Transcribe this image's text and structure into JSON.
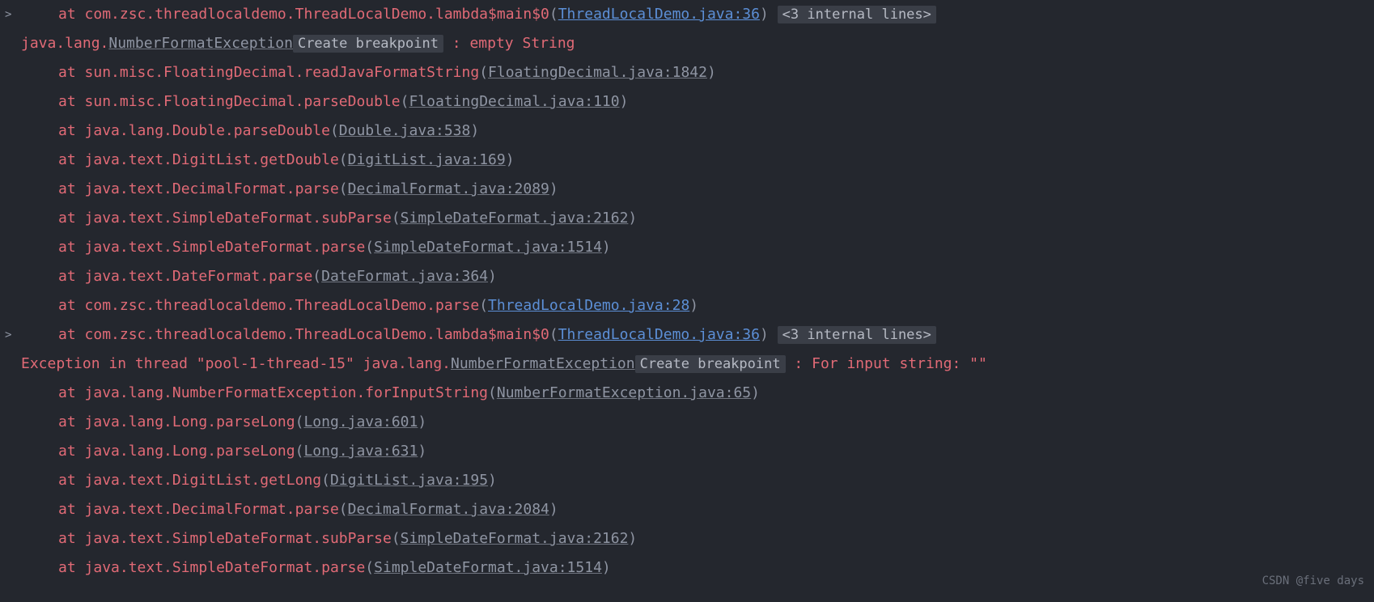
{
  "gutter": ">",
  "badges": {
    "internal": "<3 internal lines>",
    "breakpoint": "Create breakpoint"
  },
  "lines": [
    {
      "indent": 1,
      "gutter": true,
      "parts": [
        {
          "cls": "at",
          "t": "at "
        },
        {
          "cls": "red",
          "t": "com.zsc.threadlocaldemo.ThreadLocalDemo.lambda$main$0"
        },
        {
          "cls": "grey",
          "t": "("
        },
        {
          "cls": "link-blue",
          "t": "ThreadLocalDemo.java:36",
          "interact": true
        },
        {
          "cls": "grey",
          "t": ") "
        },
        {
          "badge": "internal",
          "interact": true
        }
      ]
    },
    {
      "indent": 0,
      "parts": [
        {
          "cls": "red",
          "t": "java.lang."
        },
        {
          "cls": "link-grey",
          "t": "NumberFormatException",
          "interact": true
        },
        {
          "badge": "breakpoint",
          "interact": true
        },
        {
          "cls": "red",
          "t": " : empty String"
        }
      ]
    },
    {
      "indent": 1,
      "parts": [
        {
          "cls": "at",
          "t": "at "
        },
        {
          "cls": "red",
          "t": "sun.misc.FloatingDecimal.readJavaFormatString"
        },
        {
          "cls": "grey",
          "t": "("
        },
        {
          "cls": "link-grey",
          "t": "FloatingDecimal.java:1842",
          "interact": true
        },
        {
          "cls": "grey",
          "t": ")"
        }
      ]
    },
    {
      "indent": 1,
      "parts": [
        {
          "cls": "at",
          "t": "at "
        },
        {
          "cls": "red",
          "t": "sun.misc.FloatingDecimal.parseDouble"
        },
        {
          "cls": "grey",
          "t": "("
        },
        {
          "cls": "link-grey",
          "t": "FloatingDecimal.java:110",
          "interact": true
        },
        {
          "cls": "grey",
          "t": ")"
        }
      ]
    },
    {
      "indent": 1,
      "parts": [
        {
          "cls": "at",
          "t": "at "
        },
        {
          "cls": "red",
          "t": "java.lang.Double.parseDouble"
        },
        {
          "cls": "grey",
          "t": "("
        },
        {
          "cls": "link-grey",
          "t": "Double.java:538",
          "interact": true
        },
        {
          "cls": "grey",
          "t": ")"
        }
      ]
    },
    {
      "indent": 1,
      "parts": [
        {
          "cls": "at",
          "t": "at "
        },
        {
          "cls": "red",
          "t": "java.text.DigitList.getDouble"
        },
        {
          "cls": "grey",
          "t": "("
        },
        {
          "cls": "link-grey",
          "t": "DigitList.java:169",
          "interact": true
        },
        {
          "cls": "grey",
          "t": ")"
        }
      ]
    },
    {
      "indent": 1,
      "parts": [
        {
          "cls": "at",
          "t": "at "
        },
        {
          "cls": "red",
          "t": "java.text.DecimalFormat.parse"
        },
        {
          "cls": "grey",
          "t": "("
        },
        {
          "cls": "link-grey",
          "t": "DecimalFormat.java:2089",
          "interact": true
        },
        {
          "cls": "grey",
          "t": ")"
        }
      ]
    },
    {
      "indent": 1,
      "parts": [
        {
          "cls": "at",
          "t": "at "
        },
        {
          "cls": "red",
          "t": "java.text.SimpleDateFormat.subParse"
        },
        {
          "cls": "grey",
          "t": "("
        },
        {
          "cls": "link-grey",
          "t": "SimpleDateFormat.java:2162",
          "interact": true
        },
        {
          "cls": "grey",
          "t": ")"
        }
      ]
    },
    {
      "indent": 1,
      "parts": [
        {
          "cls": "at",
          "t": "at "
        },
        {
          "cls": "red",
          "t": "java.text.SimpleDateFormat.parse"
        },
        {
          "cls": "grey",
          "t": "("
        },
        {
          "cls": "link-grey",
          "t": "SimpleDateFormat.java:1514",
          "interact": true
        },
        {
          "cls": "grey",
          "t": ")"
        }
      ]
    },
    {
      "indent": 1,
      "parts": [
        {
          "cls": "at",
          "t": "at "
        },
        {
          "cls": "red",
          "t": "java.text.DateFormat.parse"
        },
        {
          "cls": "grey",
          "t": "("
        },
        {
          "cls": "link-grey",
          "t": "DateFormat.java:364",
          "interact": true
        },
        {
          "cls": "grey",
          "t": ")"
        }
      ]
    },
    {
      "indent": 1,
      "parts": [
        {
          "cls": "at",
          "t": "at "
        },
        {
          "cls": "red",
          "t": "com.zsc.threadlocaldemo.ThreadLocalDemo.parse"
        },
        {
          "cls": "grey",
          "t": "("
        },
        {
          "cls": "link-blue",
          "t": "ThreadLocalDemo.java:28",
          "interact": true
        },
        {
          "cls": "grey",
          "t": ")"
        }
      ]
    },
    {
      "indent": 1,
      "gutter": true,
      "parts": [
        {
          "cls": "at",
          "t": "at "
        },
        {
          "cls": "red",
          "t": "com.zsc.threadlocaldemo.ThreadLocalDemo.lambda$main$0"
        },
        {
          "cls": "grey",
          "t": "("
        },
        {
          "cls": "link-blue",
          "t": "ThreadLocalDemo.java:36",
          "interact": true
        },
        {
          "cls": "grey",
          "t": ") "
        },
        {
          "badge": "internal",
          "interact": true
        }
      ]
    },
    {
      "indent": 0,
      "parts": [
        {
          "cls": "red",
          "t": "Exception in thread \"pool-1-thread-15\" java.lang."
        },
        {
          "cls": "link-grey",
          "t": "NumberFormatException",
          "interact": true
        },
        {
          "badge": "breakpoint",
          "interact": true
        },
        {
          "cls": "red",
          "t": " : For input string: \"\""
        }
      ]
    },
    {
      "indent": 1,
      "parts": [
        {
          "cls": "at",
          "t": "at "
        },
        {
          "cls": "red",
          "t": "java.lang.NumberFormatException.forInputString"
        },
        {
          "cls": "grey",
          "t": "("
        },
        {
          "cls": "link-grey",
          "t": "NumberFormatException.java:65",
          "interact": true
        },
        {
          "cls": "grey",
          "t": ")"
        }
      ]
    },
    {
      "indent": 1,
      "parts": [
        {
          "cls": "at",
          "t": "at "
        },
        {
          "cls": "red",
          "t": "java.lang.Long.parseLong"
        },
        {
          "cls": "grey",
          "t": "("
        },
        {
          "cls": "link-grey",
          "t": "Long.java:601",
          "interact": true
        },
        {
          "cls": "grey",
          "t": ")"
        }
      ]
    },
    {
      "indent": 1,
      "parts": [
        {
          "cls": "at",
          "t": "at "
        },
        {
          "cls": "red",
          "t": "java.lang.Long.parseLong"
        },
        {
          "cls": "grey",
          "t": "("
        },
        {
          "cls": "link-grey",
          "t": "Long.java:631",
          "interact": true
        },
        {
          "cls": "grey",
          "t": ")"
        }
      ]
    },
    {
      "indent": 1,
      "parts": [
        {
          "cls": "at",
          "t": "at "
        },
        {
          "cls": "red",
          "t": "java.text.DigitList.getLong"
        },
        {
          "cls": "grey",
          "t": "("
        },
        {
          "cls": "link-grey",
          "t": "DigitList.java:195",
          "interact": true
        },
        {
          "cls": "grey",
          "t": ")"
        }
      ]
    },
    {
      "indent": 1,
      "parts": [
        {
          "cls": "at",
          "t": "at "
        },
        {
          "cls": "red",
          "t": "java.text.DecimalFormat.parse"
        },
        {
          "cls": "grey",
          "t": "("
        },
        {
          "cls": "link-grey",
          "t": "DecimalFormat.java:2084",
          "interact": true
        },
        {
          "cls": "grey",
          "t": ")"
        }
      ]
    },
    {
      "indent": 1,
      "parts": [
        {
          "cls": "at",
          "t": "at "
        },
        {
          "cls": "red",
          "t": "java.text.SimpleDateFormat.subParse"
        },
        {
          "cls": "grey",
          "t": "("
        },
        {
          "cls": "link-grey",
          "t": "SimpleDateFormat.java:2162",
          "interact": true
        },
        {
          "cls": "grey",
          "t": ")"
        }
      ]
    },
    {
      "indent": 1,
      "cutoff": true,
      "parts": [
        {
          "cls": "at",
          "t": "at "
        },
        {
          "cls": "red",
          "t": "java.text.SimpleDateFormat.parse"
        },
        {
          "cls": "grey",
          "t": "("
        },
        {
          "cls": "link-grey",
          "t": "SimpleDateFormat.java:1514",
          "interact": true
        },
        {
          "cls": "grey",
          "t": ")"
        }
      ]
    }
  ],
  "watermark": "CSDN @five days"
}
